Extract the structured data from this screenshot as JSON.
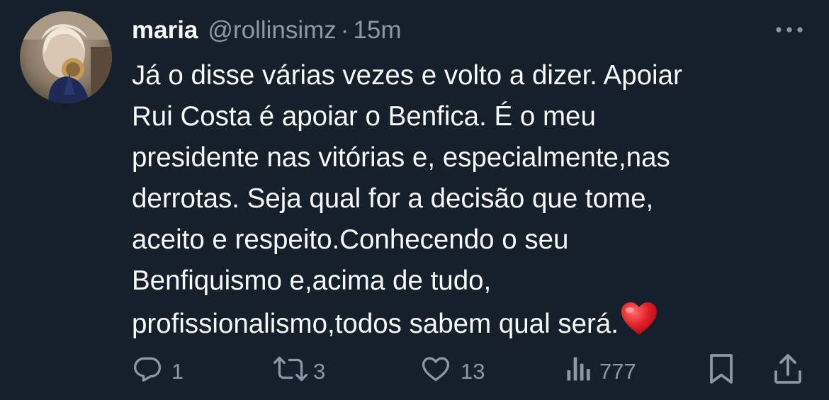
{
  "author": {
    "display_name": "maria",
    "handle": "@rollinsimz",
    "separator": "·",
    "time": "15m"
  },
  "tweet": {
    "lines": [
      "Já o disse várias vezes e volto a dizer. Apoiar",
      "Rui Costa é apoiar o Benfica. É o meu",
      "presidente nas vitórias e, especialmente,nas",
      "derrotas. Seja qual for a decisão que tome,",
      "aceito e respeito.Conhecendo o seu",
      "Benfiquismo e,acima de tudo,",
      "profissionalismo,todos sabem qual será."
    ],
    "trailing_emoji": "red-heart-emoji"
  },
  "actions": {
    "replies": "1",
    "retweets": "3",
    "likes": "13",
    "views": "777"
  },
  "icons": {
    "more": "more-icon",
    "reply": "reply-icon",
    "retweet": "retweet-icon",
    "like": "heart-icon",
    "views": "views-icon",
    "bookmark": "bookmark-icon",
    "share": "share-icon"
  },
  "colors": {
    "background": "#15202b",
    "text_primary": "#f7f9f9",
    "text_secondary": "#8b98a5",
    "heart_emoji": "#e0202a"
  }
}
